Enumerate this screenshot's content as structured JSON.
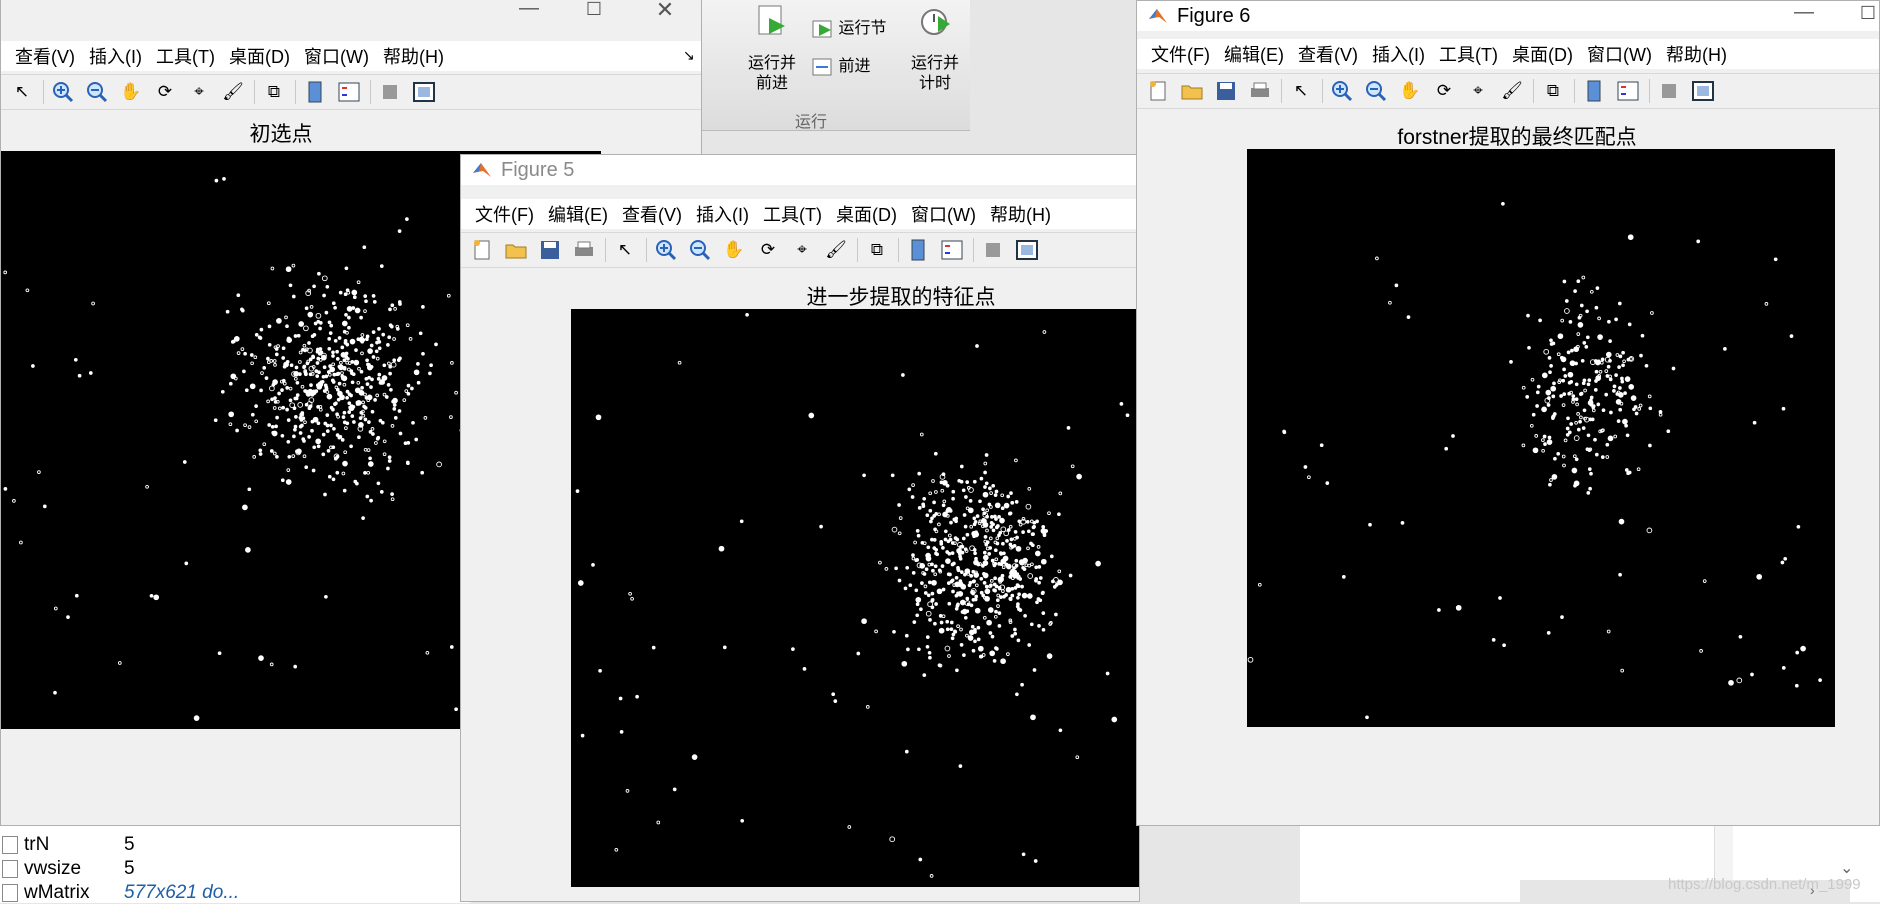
{
  "background_app": {
    "ribbon": {
      "run_partial": "行",
      "run_advance": "运行并\n前进",
      "run_section": "运行节",
      "advance": "前进",
      "run_timed": "运行并\n计时",
      "group_label": "运行"
    },
    "workspace": {
      "rows": [
        {
          "name": "trN",
          "value": "5"
        },
        {
          "name": "vwsize",
          "value": "5"
        },
        {
          "name": "wMatrix",
          "value": "577x621 do..."
        }
      ]
    },
    "watermark": "https://blog.csdn.net/m_1999"
  },
  "menu_common": [
    "文件(F)",
    "编辑(E)",
    "查看(V)",
    "插入(I)",
    "工具(T)",
    "桌面(D)",
    "窗口(W)",
    "帮助(H)"
  ],
  "menu_partial": [
    "查看(V)",
    "插入(I)",
    "工具(T)",
    "桌面(D)",
    "窗口(W)",
    "帮助(H)"
  ],
  "window_initial": {
    "axes_title": "初选点"
  },
  "window_fig5": {
    "title": "Figure 5",
    "axes_title": "进一步提取的特征点"
  },
  "window_fig6": {
    "title": "Figure 6",
    "axes_title": "forstner提取的最终匹配点"
  },
  "icons": [
    "new-file-icon",
    "open-folder-icon",
    "save-icon",
    "print-icon",
    "pointer-icon",
    "zoom-in-icon",
    "zoom-out-icon",
    "pan-hand-icon",
    "rotate-3d-icon",
    "data-cursor-icon",
    "brush-icon",
    "link-plot-icon",
    "colorbar-icon",
    "legend-icon",
    "hide-plot-tools-icon",
    "show-plot-tools-icon"
  ],
  "colors": {
    "plot_bg": "#000000",
    "points": "#ffffff",
    "window_bg": "#f0f0f0"
  }
}
